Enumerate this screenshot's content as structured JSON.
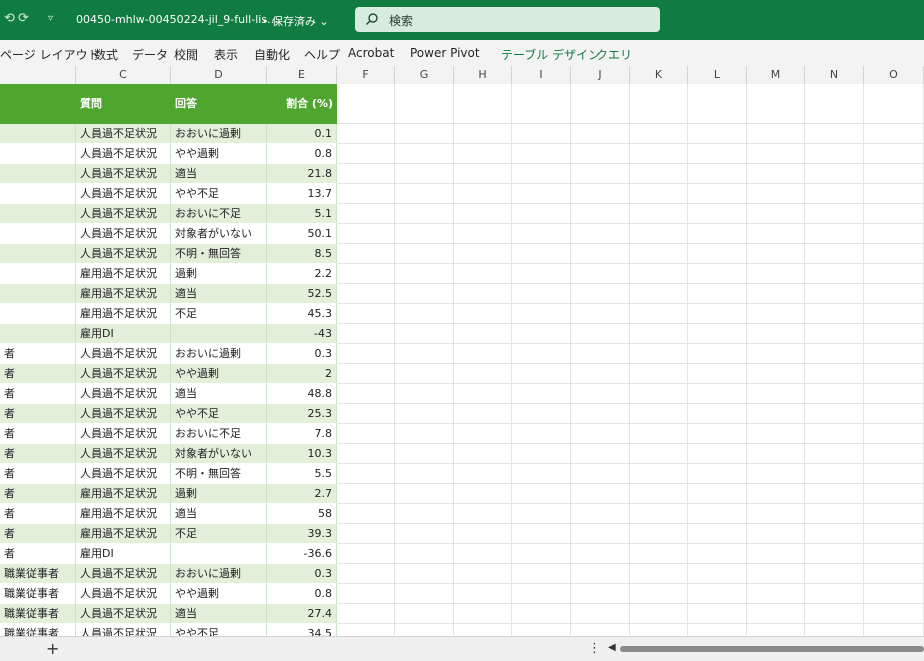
{
  "titlebar": {
    "undo": "⟲",
    "redo": "⟳",
    "qa_more": "▿",
    "doc_title": "00450-mhlw-00450224-jil_9-full-lis…",
    "saved_status": "• 保存済み ⌄",
    "search_label": "検索"
  },
  "ribbon_tabs": [
    "ページ レイアウト",
    "数式",
    "データ",
    "校閲",
    "表示",
    "自動化",
    "ヘルプ",
    "Acrobat",
    "Power Pivot",
    "テーブル デザイン",
    "クエリ"
  ],
  "columns": [
    "C",
    "D",
    "E",
    "F",
    "G",
    "H",
    "I",
    "J",
    "K",
    "L",
    "M",
    "N",
    "O"
  ],
  "table": {
    "headers": {
      "question": "質問",
      "answer": "回答",
      "ratio": "割合 (%)"
    },
    "rows": [
      {
        "b": "",
        "question": "人員過不足状況",
        "answer": "おおいに過剰",
        "ratio": "0.1"
      },
      {
        "b": "",
        "question": "人員過不足状況",
        "answer": "やや過剰",
        "ratio": "0.8"
      },
      {
        "b": "",
        "question": "人員過不足状況",
        "answer": "適当",
        "ratio": "21.8"
      },
      {
        "b": "",
        "question": "人員過不足状況",
        "answer": "やや不足",
        "ratio": "13.7"
      },
      {
        "b": "",
        "question": "人員過不足状況",
        "answer": "おおいに不足",
        "ratio": "5.1"
      },
      {
        "b": "",
        "question": "人員過不足状況",
        "answer": "対象者がいない",
        "ratio": "50.1"
      },
      {
        "b": "",
        "question": "人員過不足状況",
        "answer": "不明・無回答",
        "ratio": "8.5"
      },
      {
        "b": "",
        "question": "雇用過不足状況",
        "answer": "過剰",
        "ratio": "2.2"
      },
      {
        "b": "",
        "question": "雇用過不足状況",
        "answer": "適当",
        "ratio": "52.5"
      },
      {
        "b": "",
        "question": "雇用過不足状況",
        "answer": "不足",
        "ratio": "45.3"
      },
      {
        "b": "",
        "question": "雇用DI",
        "answer": "",
        "ratio": "-43"
      },
      {
        "b": "者",
        "question": "人員過不足状況",
        "answer": "おおいに過剰",
        "ratio": "0.3"
      },
      {
        "b": "者",
        "question": "人員過不足状況",
        "answer": "やや過剰",
        "ratio": "2"
      },
      {
        "b": "者",
        "question": "人員過不足状況",
        "answer": "適当",
        "ratio": "48.8"
      },
      {
        "b": "者",
        "question": "人員過不足状況",
        "answer": "やや不足",
        "ratio": "25.3"
      },
      {
        "b": "者",
        "question": "人員過不足状況",
        "answer": "おおいに不足",
        "ratio": "7.8"
      },
      {
        "b": "者",
        "question": "人員過不足状況",
        "answer": "対象者がいない",
        "ratio": "10.3"
      },
      {
        "b": "者",
        "question": "人員過不足状況",
        "answer": "不明・無回答",
        "ratio": "5.5"
      },
      {
        "b": "者",
        "question": "雇用過不足状況",
        "answer": "過剰",
        "ratio": "2.7"
      },
      {
        "b": "者",
        "question": "雇用過不足状況",
        "answer": "適当",
        "ratio": "58"
      },
      {
        "b": "者",
        "question": "雇用過不足状況",
        "answer": "不足",
        "ratio": "39.3"
      },
      {
        "b": "者",
        "question": "雇用DI",
        "answer": "",
        "ratio": "-36.6"
      },
      {
        "b": "職業従事者",
        "question": "人員過不足状況",
        "answer": "おおいに過剰",
        "ratio": "0.3"
      },
      {
        "b": "職業従事者",
        "question": "人員過不足状況",
        "answer": "やや過剰",
        "ratio": "0.8"
      },
      {
        "b": "職業従事者",
        "question": "人員過不足状況",
        "answer": "適当",
        "ratio": "27.4"
      },
      {
        "b": "職業従事者",
        "question": "人員過不足状況",
        "answer": "やや不足",
        "ratio": "34.5"
      }
    ]
  },
  "statusbar": {
    "add_sheet": "+",
    "more": "⋮",
    "scroll_left": "◀"
  },
  "colors": {
    "titlebar": "#107c41",
    "table_header": "#4ea62e",
    "band": "#e2efda",
    "context_tab": "#107c41"
  }
}
